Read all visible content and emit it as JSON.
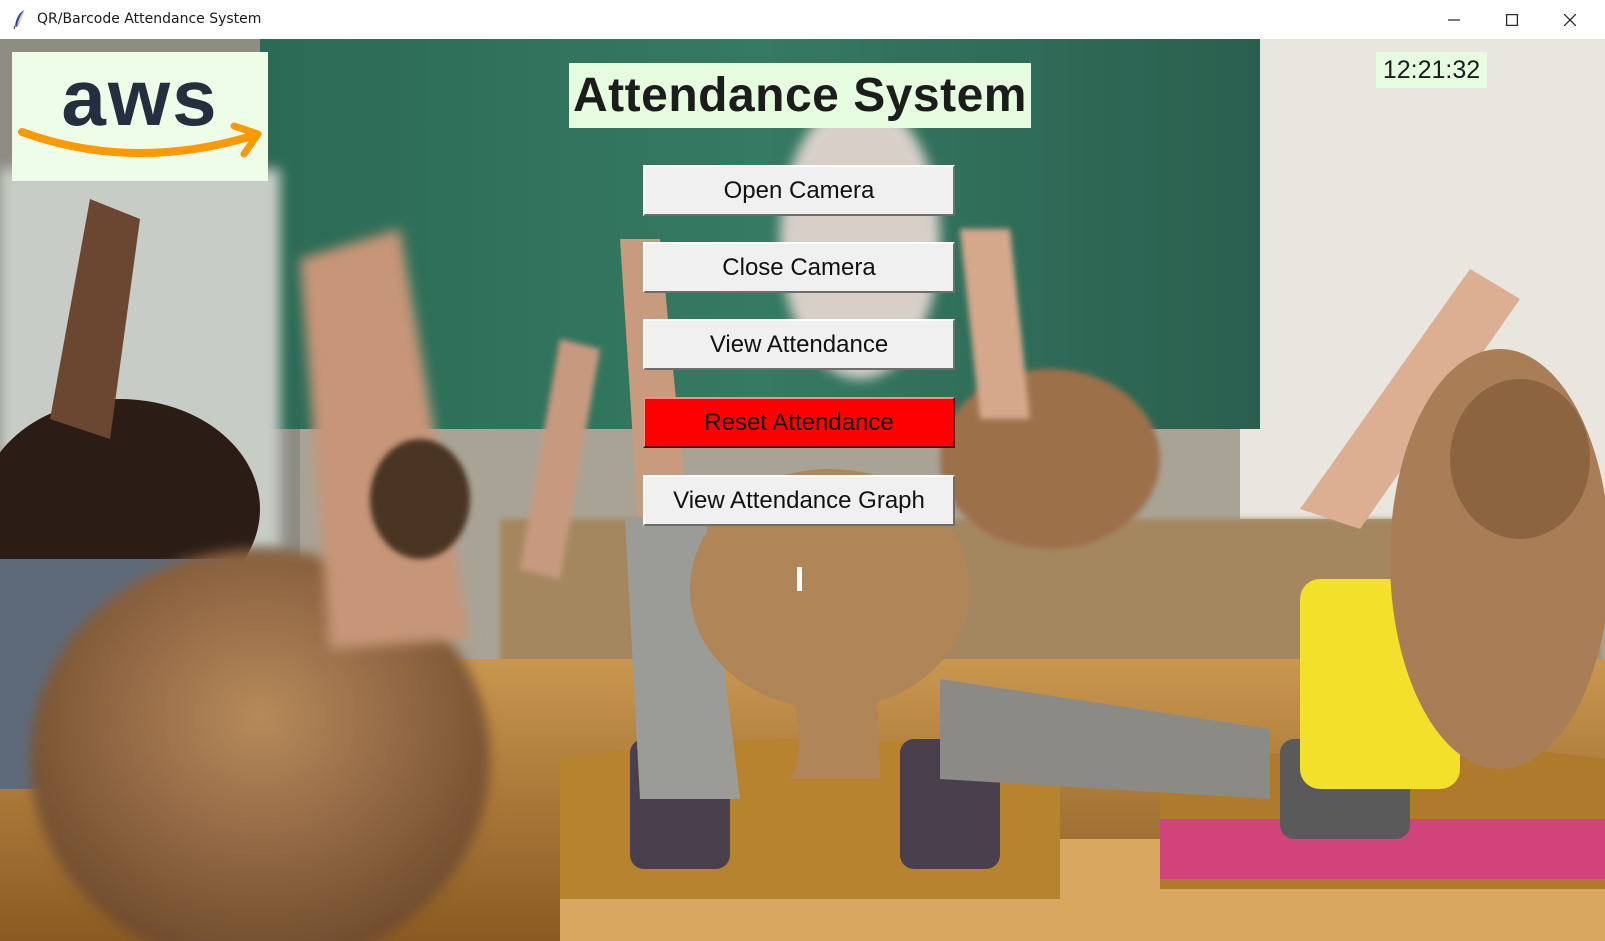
{
  "window": {
    "title": "QR/Barcode Attendance System",
    "controls": [
      "minimize",
      "maximize",
      "close"
    ]
  },
  "logo": {
    "text": "aws",
    "icon": "aws-logo",
    "background": "#eefde8"
  },
  "heading": "Attendance System",
  "clock": "12:21:32",
  "buttons": {
    "open_camera": "Open Camera",
    "close_camera": "Close Camera",
    "view_attendance": "View Attendance",
    "reset_attendance": "Reset Attendance",
    "view_graph": "View Attendance Graph"
  },
  "colors": {
    "label_background": "#e6fde0",
    "button_face": "#f0f0f0",
    "reset_button": "#ff0000",
    "aws_orange": "#ff9900",
    "aws_navy": "#232f3e"
  },
  "background_image": "classroom-students-raising-hands"
}
